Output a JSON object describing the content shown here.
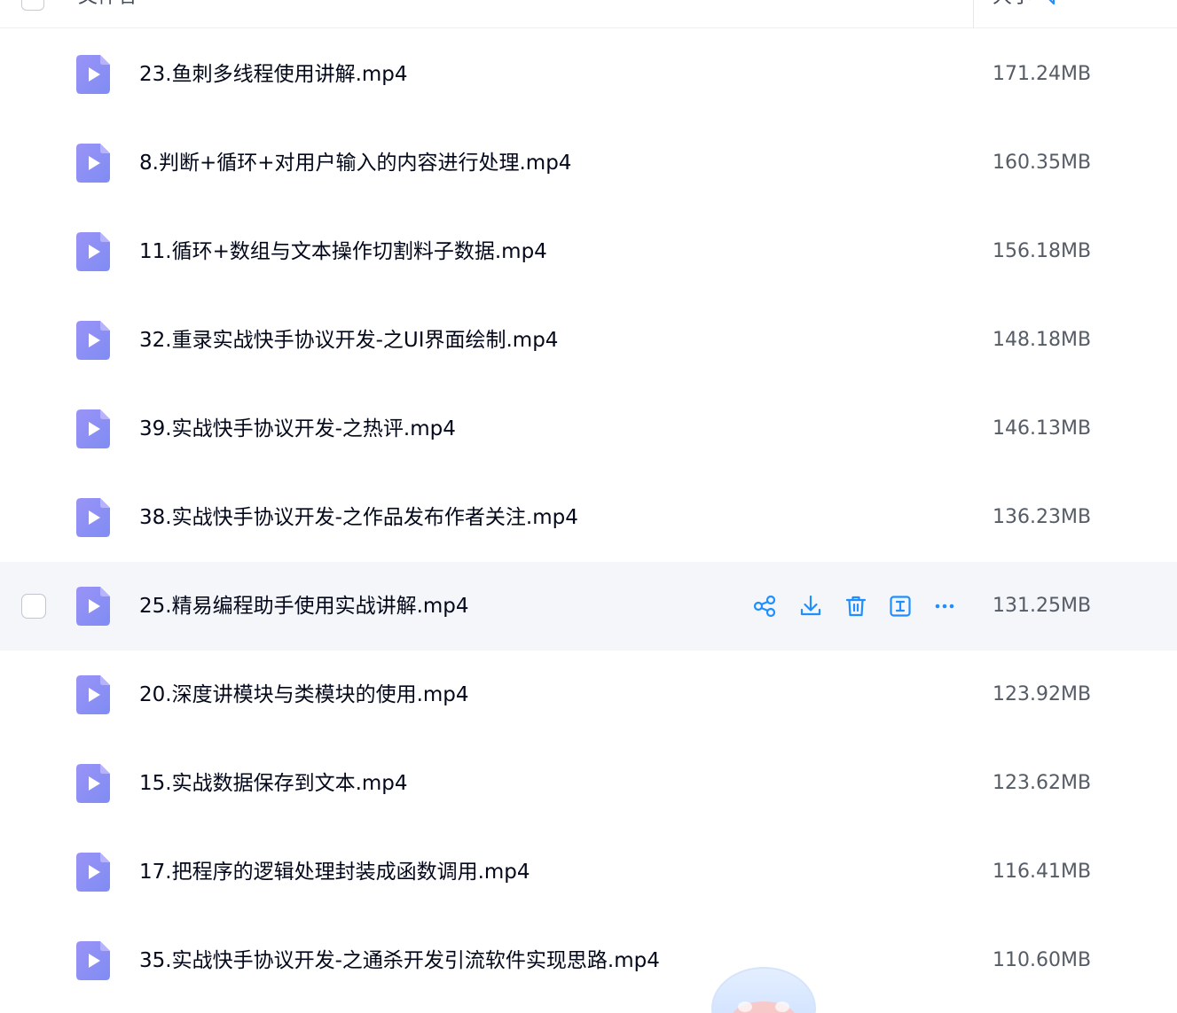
{
  "header": {
    "name_label": "文件名",
    "size_label": "大小"
  },
  "files": [
    {
      "name": "23.鱼刺多线程使用讲解.mp4",
      "size": "171.24MB"
    },
    {
      "name": "8.判断+循环+对用户输入的内容进行处理.mp4",
      "size": "160.35MB"
    },
    {
      "name": "11.循环+数组与文本操作切割料子数据.mp4",
      "size": "156.18MB"
    },
    {
      "name": "32.重录实战快手协议开发-之UI界面绘制.mp4",
      "size": "148.18MB"
    },
    {
      "name": "39.实战快手协议开发-之热评.mp4",
      "size": "146.13MB"
    },
    {
      "name": "38.实战快手协议开发-之作品发布作者关注.mp4",
      "size": "136.23MB"
    },
    {
      "name": "25.精易编程助手使用实战讲解.mp4",
      "size": "131.25MB"
    },
    {
      "name": "20.深度讲模块与类模块的使用.mp4",
      "size": "123.92MB"
    },
    {
      "name": "15.实战数据保存到文本.mp4",
      "size": "123.62MB"
    },
    {
      "name": "17.把程序的逻辑处理封装成函数调用.mp4",
      "size": "116.41MB"
    },
    {
      "name": "35.实战快手协议开发-之通杀开发引流软件实现思路.mp4",
      "size": "110.60MB"
    }
  ],
  "hovered_row_index": 6,
  "row_actions": [
    "share-icon",
    "download-icon",
    "delete-icon",
    "rename-icon",
    "more-icon"
  ],
  "colors": {
    "accent": "#1f8fff",
    "file_icon": "#8c8cf5",
    "hover_row_bg": "#f5f6fa"
  }
}
